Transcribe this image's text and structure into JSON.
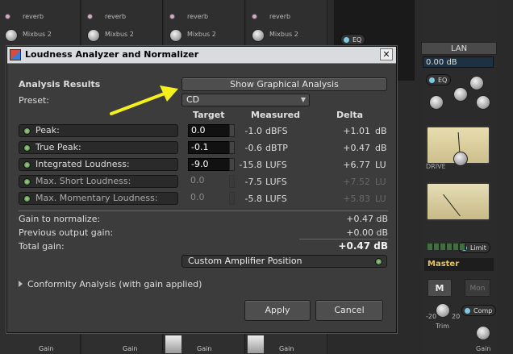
{
  "background": {
    "strips": [
      {
        "reverb": "reverb",
        "mixbus": "Mixbus 2",
        "gain": "Gain"
      },
      {
        "reverb": "reverb",
        "mixbus": "Mixbus 2",
        "gain": "Gain"
      },
      {
        "reverb": "reverb",
        "mixbus": "Mixbus 2",
        "gain": "Gain"
      },
      {
        "reverb": "reverb",
        "mixbus": "Mixbus 2",
        "gain": "Gain"
      }
    ],
    "eq_label": "EQ",
    "right_panel": {
      "title": "LAN",
      "db_value": "0.00 dB",
      "eq_label": "EQ",
      "drive_label": "DRIVE",
      "limit_label": "Limit",
      "master_label": "Master",
      "m_label": "M",
      "mon_label": "Mon",
      "comp_label": "Comp",
      "trim_label": "Trim",
      "gain_label": "Gain",
      "neg20": "-20",
      "pos20": "20"
    }
  },
  "dialog": {
    "title": "Loudness Analyzer and Normalizer",
    "close": "✕",
    "analysis_results": "Analysis Results",
    "show_graphical": "Show Graphical Analysis",
    "preset_label": "Preset:",
    "preset_value": "CD",
    "headers": {
      "target": "Target",
      "measured": "Measured",
      "delta": "Delta"
    },
    "rows": [
      {
        "label": "Peak:",
        "target": "0.0",
        "measured": "-1.0",
        "m_unit": "dBFS",
        "delta": "+1.01",
        "d_unit": "dB",
        "enabled": true
      },
      {
        "label": "True Peak:",
        "target": "-0.1",
        "measured": "-0.6",
        "m_unit": "dBTP",
        "delta": "+0.47",
        "d_unit": "dB",
        "enabled": true
      },
      {
        "label": "Integrated Loudness:",
        "target": "-9.0",
        "measured": "-15.8",
        "m_unit": "LUFS",
        "delta": "+6.77",
        "d_unit": "LU",
        "enabled": true
      },
      {
        "label": "Max. Short Loudness:",
        "target": "0.0",
        "measured": "-7.5",
        "m_unit": "LUFS",
        "delta": "+7.52",
        "d_unit": "LU",
        "enabled": false
      },
      {
        "label": "Max. Momentary Loudness:",
        "target": "0.0",
        "measured": "-5.8",
        "m_unit": "LUFS",
        "delta": "+5.83",
        "d_unit": "LU",
        "enabled": false
      }
    ],
    "summary": [
      {
        "label": "Gain to normalize:",
        "value": "+0.47  dB"
      },
      {
        "label": "Previous output gain:",
        "value": "+0.00  dB"
      },
      {
        "label": "Total gain:",
        "value": "+0.47  dB"
      }
    ],
    "custom_amp": "Custom Amplifier Position",
    "conformity": "Conformity Analysis (with gain applied)",
    "apply": "Apply",
    "cancel": "Cancel"
  },
  "colors": {
    "annotation_arrow": "#f4f01c"
  }
}
